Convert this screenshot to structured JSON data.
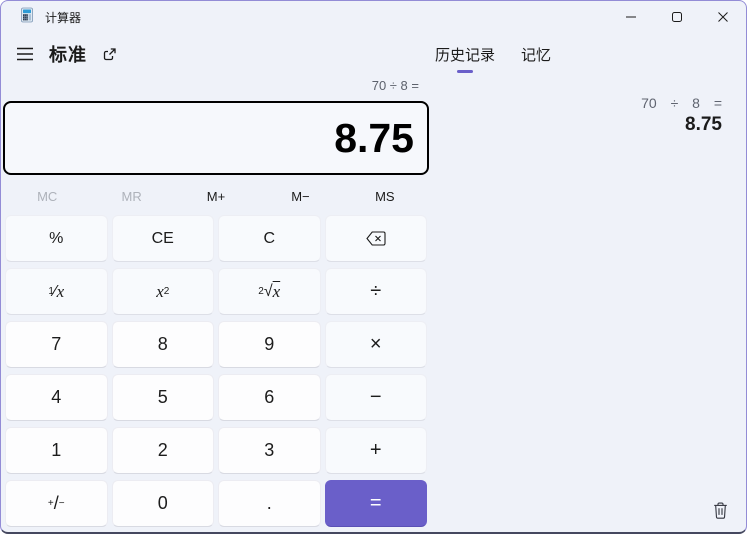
{
  "window": {
    "title": "计算器",
    "controls": {
      "minimize": "最小化",
      "maximize": "最大化",
      "close": "关闭"
    }
  },
  "toolbar": {
    "mode_label": "标准"
  },
  "tabs": {
    "history": {
      "label": "历史记录",
      "active": true
    },
    "memory": {
      "label": "记忆",
      "active": false
    }
  },
  "display": {
    "expression": "70 ÷ 8 =",
    "value": "8.75"
  },
  "memory_bar": {
    "buttons": [
      {
        "name": "memory-clear",
        "label": "MC",
        "enabled": false
      },
      {
        "name": "memory-recall",
        "label": "MR",
        "enabled": false
      },
      {
        "name": "memory-add",
        "label": "M+",
        "enabled": true
      },
      {
        "name": "memory-subtract",
        "label": "M−",
        "enabled": true
      },
      {
        "name": "memory-store",
        "label": "MS",
        "enabled": true
      }
    ]
  },
  "keypad": {
    "buttons": [
      {
        "name": "percent",
        "html": "%",
        "type": "function"
      },
      {
        "name": "clear-entry",
        "html": "CE",
        "type": "function"
      },
      {
        "name": "clear",
        "html": "C",
        "type": "function"
      },
      {
        "name": "backspace",
        "icon": "backspace-icon",
        "type": "function"
      },
      {
        "name": "reciprocal",
        "html": "<sup>1</sup>⁄<i>x</i>",
        "type": "function"
      },
      {
        "name": "square",
        "html": "<i>x</i><sup>2</sup>",
        "type": "function"
      },
      {
        "name": "square-root",
        "html": "<sup>2</sup>√<span class='ovl'><i>x</i></span>",
        "type": "function"
      },
      {
        "name": "divide",
        "html": "÷",
        "type": "operator"
      },
      {
        "name": "seven",
        "html": "7",
        "type": "number"
      },
      {
        "name": "eight",
        "html": "8",
        "type": "number"
      },
      {
        "name": "nine",
        "html": "9",
        "type": "number"
      },
      {
        "name": "multiply",
        "html": "×",
        "type": "operator"
      },
      {
        "name": "four",
        "html": "4",
        "type": "number"
      },
      {
        "name": "five",
        "html": "5",
        "type": "number"
      },
      {
        "name": "six",
        "html": "6",
        "type": "number"
      },
      {
        "name": "subtract",
        "html": "−",
        "type": "operator"
      },
      {
        "name": "one",
        "html": "1",
        "type": "number"
      },
      {
        "name": "two",
        "html": "2",
        "type": "number"
      },
      {
        "name": "three",
        "html": "3",
        "type": "number"
      },
      {
        "name": "add",
        "html": "+",
        "type": "operator"
      },
      {
        "name": "negate",
        "html": "<sup>+</sup>/<sub>−</sub>",
        "type": "number"
      },
      {
        "name": "zero",
        "html": "0",
        "type": "number"
      },
      {
        "name": "decimal",
        "html": ".",
        "type": "number"
      },
      {
        "name": "equals",
        "html": "=",
        "type": "equals"
      }
    ]
  },
  "history_panel": {
    "entries": [
      {
        "expression": "70 ÷ 8 =",
        "result": "8.75"
      }
    ],
    "clear_icon": "trash-icon"
  },
  "colors": {
    "accent": "#6a5fc9",
    "window_border": "#938cd6",
    "background": "#eff2f9",
    "disabled_text": "#aeb2ba"
  }
}
